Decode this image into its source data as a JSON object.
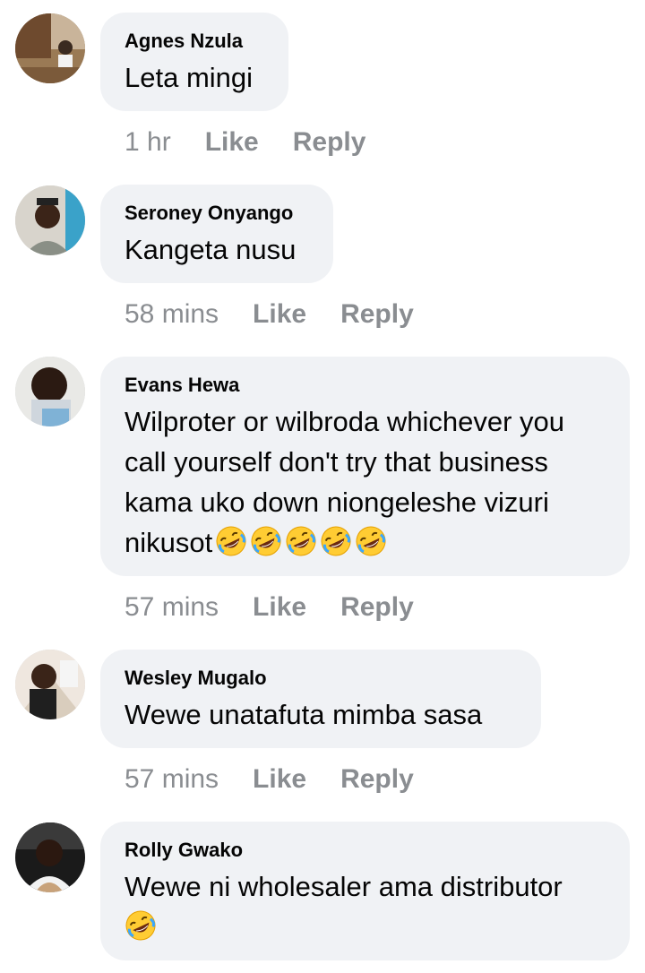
{
  "comments": [
    {
      "author": "Agnes Nzula",
      "text": "Leta mingi",
      "time": "1 hr",
      "like_label": "Like",
      "reply_label": "Reply",
      "avatar": "photo-avatar"
    },
    {
      "author": "Seroney Onyango",
      "text": "Kangeta nusu",
      "time": "58 mins",
      "like_label": "Like",
      "reply_label": "Reply",
      "avatar": "photo-avatar"
    },
    {
      "author": "Evans Hewa",
      "text": "Wilproter or wilbroda whichever you call yourself don't try that business kama uko down niongeleshe vizuri nikusot",
      "emoji_count": 5,
      "emoji": "rolling-laughing-emoji",
      "time": "57 mins",
      "like_label": "Like",
      "reply_label": "Reply",
      "avatar": "photo-avatar"
    },
    {
      "author": "Wesley Mugalo",
      "text": "Wewe unatafuta mimba sasa",
      "time": "57 mins",
      "like_label": "Like",
      "reply_label": "Reply",
      "avatar": "photo-avatar"
    },
    {
      "author": "Rolly Gwako",
      "text": "Wewe ni wholesaler ama distributor",
      "emoji_count": 1,
      "emoji": "rolling-laughing-emoji",
      "avatar": "photo-avatar"
    }
  ],
  "colors": {
    "bubble": "#f0f2f5",
    "meta": "#8a8d91",
    "text": "#050505"
  }
}
